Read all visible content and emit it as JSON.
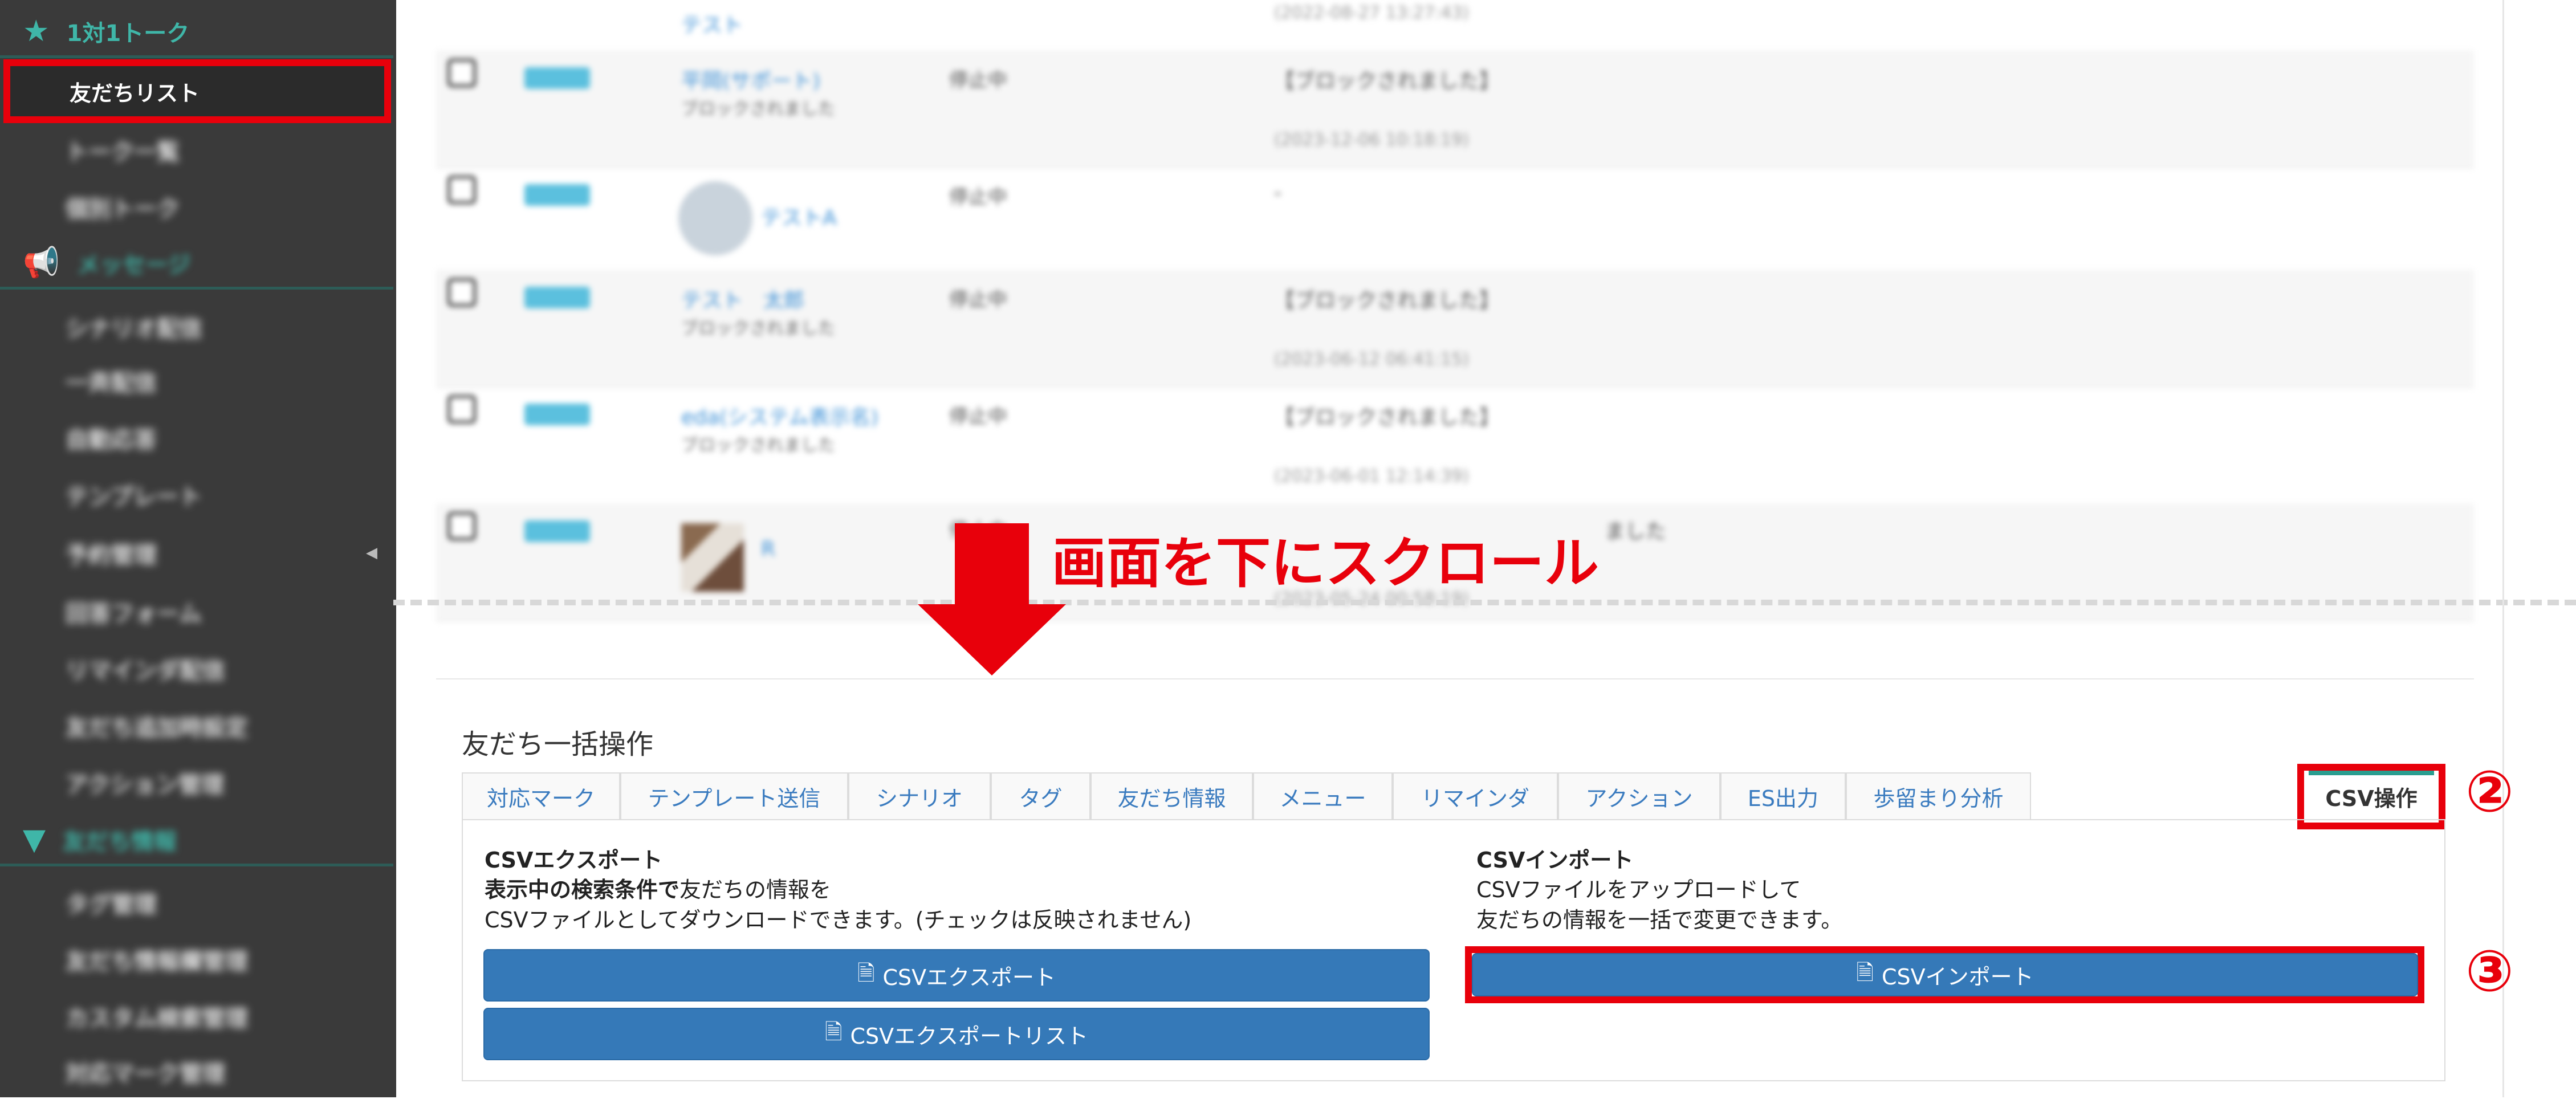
{
  "sidebar": {
    "section_talk": "1対1トーク",
    "active_item": "友だちリスト",
    "talk_items": [
      "トーク一覧",
      "個別トーク"
    ],
    "section_message": "メッセージ",
    "message_items": [
      "シナリオ配信",
      "一斉配信",
      "自動応答",
      "テンプレート",
      "予約管理",
      "回答フォーム",
      "リマインダ配信",
      "友だち追加時設定",
      "アクション管理"
    ],
    "section_friends": "友だち情報",
    "friend_items": [
      "タグ管理",
      "友だち情報欄管理",
      "カスタム検索管理",
      "対応マーク管理"
    ]
  },
  "list": {
    "rows": [
      {
        "badge": "",
        "name": "テスト",
        "sub": "",
        "status": "",
        "msg": "",
        "date": "(2022-08-27 13:27:43)"
      },
      {
        "badge": "",
        "name": "平岡(サポート)",
        "sub": "ブロックされました",
        "status": "停止中",
        "msg": "【ブロックされました】",
        "date": "(2023-12-06 10:18:19)"
      },
      {
        "badge": "",
        "name": "テストA",
        "sub": "",
        "status": "停止中",
        "msg": "-",
        "date": ""
      },
      {
        "badge": "",
        "name": "テスト　太郎",
        "sub": "ブロックされました",
        "status": "停止中",
        "msg": "【ブロックされました】",
        "date": "(2023-06-12 06:41:15)"
      },
      {
        "badge": "",
        "name": "eda(システム表示名)",
        "sub": "ブロックされました",
        "status": "停止中",
        "msg": "【ブロックされました】",
        "date": "(2023-06-01 12:14:39)"
      },
      {
        "badge": "",
        "name": "R",
        "sub": "",
        "status": "停止中",
        "msg": "ました",
        "date": "(2023-05-24 00:58:19)"
      }
    ]
  },
  "annotation": {
    "scroll_note": "画面を下にスクロール",
    "step2": "②",
    "step3": "③"
  },
  "bulk": {
    "title": "友だち一括操作",
    "tabs": [
      "対応マーク",
      "テンプレート送信",
      "シナリオ",
      "タグ",
      "友だち情報",
      "メニュー",
      "リマインダ",
      "アクション",
      "ES出力",
      "歩留まり分析"
    ],
    "active_tab": "CSV操作",
    "export": {
      "title": "CSVエクスポート",
      "line1_bold": "表示中の検索条件で",
      "line1_rest": "友だちの情報を",
      "line2": "CSVファイルとしてダウンロードできます。(チェックは反映されません)",
      "button1": "CSVエクスポート",
      "button2": "CSVエクスポートリスト"
    },
    "import": {
      "title": "CSVインポート",
      "line1": "CSVファイルをアップロードして",
      "line2": "友だちの情報を一括で変更できます。",
      "button": "CSVインポート"
    }
  }
}
